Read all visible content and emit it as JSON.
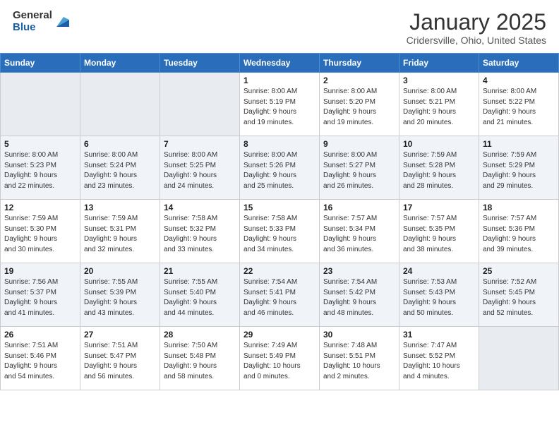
{
  "header": {
    "logo_general": "General",
    "logo_blue": "Blue",
    "title": "January 2025",
    "subtitle": "Cridersville, Ohio, United States"
  },
  "weekdays": [
    "Sunday",
    "Monday",
    "Tuesday",
    "Wednesday",
    "Thursday",
    "Friday",
    "Saturday"
  ],
  "weeks": [
    [
      {
        "date": "",
        "info": ""
      },
      {
        "date": "",
        "info": ""
      },
      {
        "date": "",
        "info": ""
      },
      {
        "date": "1",
        "info": "Sunrise: 8:00 AM\nSunset: 5:19 PM\nDaylight: 9 hours\nand 19 minutes."
      },
      {
        "date": "2",
        "info": "Sunrise: 8:00 AM\nSunset: 5:20 PM\nDaylight: 9 hours\nand 19 minutes."
      },
      {
        "date": "3",
        "info": "Sunrise: 8:00 AM\nSunset: 5:21 PM\nDaylight: 9 hours\nand 20 minutes."
      },
      {
        "date": "4",
        "info": "Sunrise: 8:00 AM\nSunset: 5:22 PM\nDaylight: 9 hours\nand 21 minutes."
      }
    ],
    [
      {
        "date": "5",
        "info": "Sunrise: 8:00 AM\nSunset: 5:23 PM\nDaylight: 9 hours\nand 22 minutes."
      },
      {
        "date": "6",
        "info": "Sunrise: 8:00 AM\nSunset: 5:24 PM\nDaylight: 9 hours\nand 23 minutes."
      },
      {
        "date": "7",
        "info": "Sunrise: 8:00 AM\nSunset: 5:25 PM\nDaylight: 9 hours\nand 24 minutes."
      },
      {
        "date": "8",
        "info": "Sunrise: 8:00 AM\nSunset: 5:26 PM\nDaylight: 9 hours\nand 25 minutes."
      },
      {
        "date": "9",
        "info": "Sunrise: 8:00 AM\nSunset: 5:27 PM\nDaylight: 9 hours\nand 26 minutes."
      },
      {
        "date": "10",
        "info": "Sunrise: 7:59 AM\nSunset: 5:28 PM\nDaylight: 9 hours\nand 28 minutes."
      },
      {
        "date": "11",
        "info": "Sunrise: 7:59 AM\nSunset: 5:29 PM\nDaylight: 9 hours\nand 29 minutes."
      }
    ],
    [
      {
        "date": "12",
        "info": "Sunrise: 7:59 AM\nSunset: 5:30 PM\nDaylight: 9 hours\nand 30 minutes."
      },
      {
        "date": "13",
        "info": "Sunrise: 7:59 AM\nSunset: 5:31 PM\nDaylight: 9 hours\nand 32 minutes."
      },
      {
        "date": "14",
        "info": "Sunrise: 7:58 AM\nSunset: 5:32 PM\nDaylight: 9 hours\nand 33 minutes."
      },
      {
        "date": "15",
        "info": "Sunrise: 7:58 AM\nSunset: 5:33 PM\nDaylight: 9 hours\nand 34 minutes."
      },
      {
        "date": "16",
        "info": "Sunrise: 7:57 AM\nSunset: 5:34 PM\nDaylight: 9 hours\nand 36 minutes."
      },
      {
        "date": "17",
        "info": "Sunrise: 7:57 AM\nSunset: 5:35 PM\nDaylight: 9 hours\nand 38 minutes."
      },
      {
        "date": "18",
        "info": "Sunrise: 7:57 AM\nSunset: 5:36 PM\nDaylight: 9 hours\nand 39 minutes."
      }
    ],
    [
      {
        "date": "19",
        "info": "Sunrise: 7:56 AM\nSunset: 5:37 PM\nDaylight: 9 hours\nand 41 minutes."
      },
      {
        "date": "20",
        "info": "Sunrise: 7:55 AM\nSunset: 5:39 PM\nDaylight: 9 hours\nand 43 minutes."
      },
      {
        "date": "21",
        "info": "Sunrise: 7:55 AM\nSunset: 5:40 PM\nDaylight: 9 hours\nand 44 minutes."
      },
      {
        "date": "22",
        "info": "Sunrise: 7:54 AM\nSunset: 5:41 PM\nDaylight: 9 hours\nand 46 minutes."
      },
      {
        "date": "23",
        "info": "Sunrise: 7:54 AM\nSunset: 5:42 PM\nDaylight: 9 hours\nand 48 minutes."
      },
      {
        "date": "24",
        "info": "Sunrise: 7:53 AM\nSunset: 5:43 PM\nDaylight: 9 hours\nand 50 minutes."
      },
      {
        "date": "25",
        "info": "Sunrise: 7:52 AM\nSunset: 5:45 PM\nDaylight: 9 hours\nand 52 minutes."
      }
    ],
    [
      {
        "date": "26",
        "info": "Sunrise: 7:51 AM\nSunset: 5:46 PM\nDaylight: 9 hours\nand 54 minutes."
      },
      {
        "date": "27",
        "info": "Sunrise: 7:51 AM\nSunset: 5:47 PM\nDaylight: 9 hours\nand 56 minutes."
      },
      {
        "date": "28",
        "info": "Sunrise: 7:50 AM\nSunset: 5:48 PM\nDaylight: 9 hours\nand 58 minutes."
      },
      {
        "date": "29",
        "info": "Sunrise: 7:49 AM\nSunset: 5:49 PM\nDaylight: 10 hours\nand 0 minutes."
      },
      {
        "date": "30",
        "info": "Sunrise: 7:48 AM\nSunset: 5:51 PM\nDaylight: 10 hours\nand 2 minutes."
      },
      {
        "date": "31",
        "info": "Sunrise: 7:47 AM\nSunset: 5:52 PM\nDaylight: 10 hours\nand 4 minutes."
      },
      {
        "date": "",
        "info": ""
      }
    ]
  ]
}
